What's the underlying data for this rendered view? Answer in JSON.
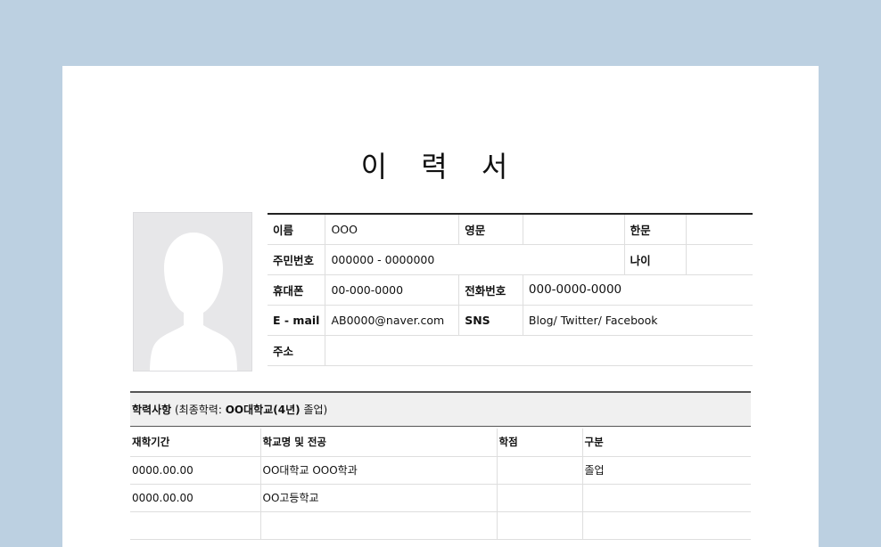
{
  "document": {
    "title": "이 력 서"
  },
  "profile": {
    "photo_icon": "person-silhouette-icon",
    "rows": [
      [
        {
          "label": "이름",
          "value": "OOO"
        },
        {
          "label": "영문",
          "value": ""
        },
        {
          "label": "한문",
          "value": ""
        }
      ],
      [
        {
          "label": "주민번호",
          "value": "000000 - 0000000"
        },
        {
          "label": "나이",
          "value": ""
        }
      ],
      [
        {
          "label": "휴대폰",
          "value": "00-000-0000"
        },
        {
          "label": "전화번호",
          "value": "000-0000-0000"
        }
      ],
      [
        {
          "label": "E - mail",
          "value": "AB0000@naver.com"
        },
        {
          "label": "SNS",
          "value": "Blog/ Twitter/ Facebook"
        }
      ],
      [
        {
          "label": "주소",
          "value": ""
        }
      ]
    ]
  },
  "education": {
    "heading": "학력사항",
    "summary_prefix": "(최종학력:",
    "summary_bold": "OO대학교(4년)",
    "summary_suffix": "졸업)",
    "columns": [
      "재학기간",
      "학교명 및 전공",
      "학점",
      "구분"
    ],
    "rows": [
      [
        "0000.00.00",
        "OO대학교 OOO학과",
        "",
        "졸업"
      ],
      [
        "0000.00.00",
        "OO고등학교",
        "",
        ""
      ],
      [
        "",
        "",
        "",
        ""
      ]
    ]
  },
  "colors": {
    "background": "#bcd0e1",
    "sheet": "#ffffff",
    "photo_placeholder": "#e7e7e9"
  }
}
